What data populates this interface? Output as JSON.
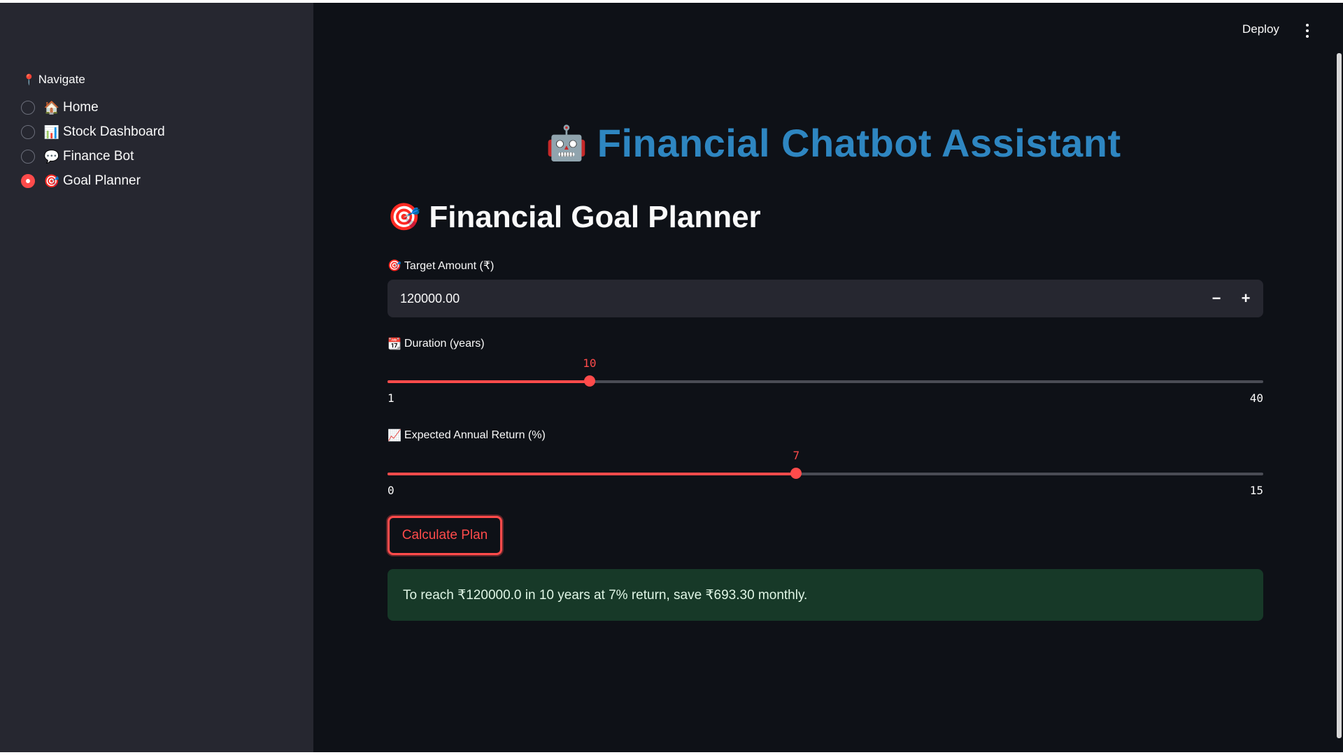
{
  "header": {
    "deploy_label": "Deploy",
    "menu_icon": "kebab-menu-icon"
  },
  "sidebar": {
    "nav_label": "Navigate",
    "nav_icon": "pin-icon",
    "items": [
      {
        "emoji": "🏠",
        "label": "Home",
        "selected": false
      },
      {
        "emoji": "📊",
        "label": "Stock Dashboard",
        "selected": false
      },
      {
        "emoji": "💬",
        "label": "Finance Bot",
        "selected": false
      },
      {
        "emoji": "🎯",
        "label": "Goal Planner",
        "selected": true
      }
    ]
  },
  "main": {
    "title_emoji": "🤖",
    "title": "Financial Chatbot Assistant",
    "subtitle_emoji": "🎯",
    "subtitle": "Financial Goal Planner",
    "target": {
      "emoji": "🎯",
      "label": "Target Amount (₹)",
      "value": "120000.00",
      "minus": "−",
      "plus": "+"
    },
    "duration": {
      "emoji": "📆",
      "label": "Duration (years)",
      "value": "10",
      "min": "1",
      "max": "40",
      "value_num": 10,
      "min_num": 1,
      "max_num": 40
    },
    "return_rate": {
      "emoji": "📈",
      "label": "Expected Annual Return (%)",
      "value": "7",
      "min": "0",
      "max": "15",
      "value_num": 7,
      "min_num": 0,
      "max_num": 15
    },
    "calculate_label": "Calculate Plan",
    "result_text": "To reach ₹120000.0 in 10 years at 7% return, save ₹693.30 monthly."
  },
  "colors": {
    "accent": "#ff4b4b",
    "title_blue": "#2e86c1",
    "background": "#0e1117",
    "sidebar": "#262730",
    "success_bg": "#173928"
  }
}
